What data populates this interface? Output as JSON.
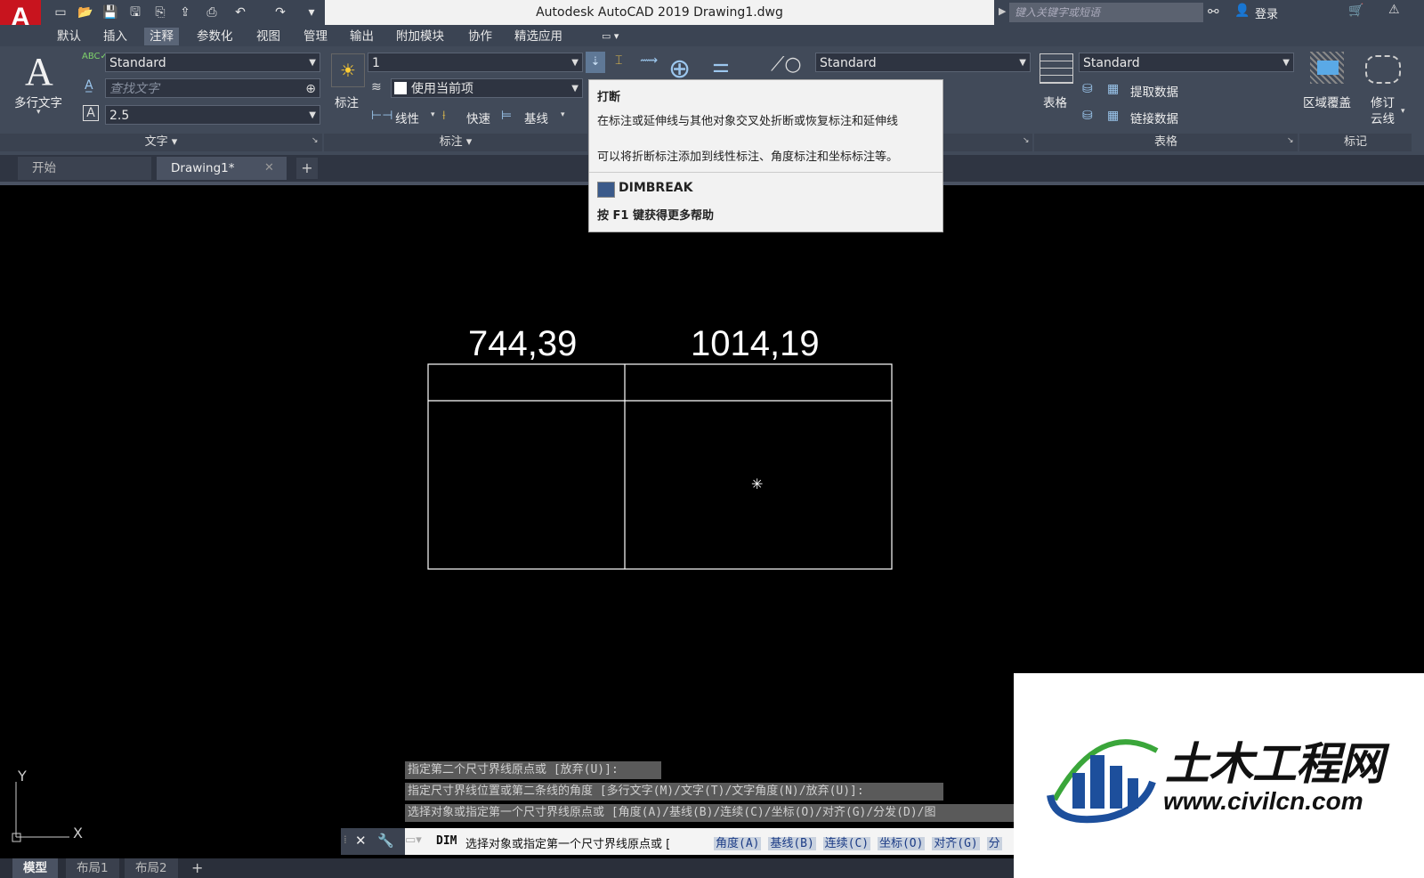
{
  "app": {
    "logo": "A",
    "title": "Autodesk AutoCAD 2019    Drawing1.dwg",
    "search_placeholder": "键入关键字或短语",
    "login": "登录"
  },
  "menu_tabs": [
    "默认",
    "插入",
    "注释",
    "参数化",
    "视图",
    "管理",
    "输出",
    "附加模块",
    "协作",
    "精选应用"
  ],
  "active_tab": "注释",
  "ribbon": {
    "text_panel": {
      "multiline_text": "多行文字",
      "style_combo": "Standard",
      "find_placeholder": "查找文字",
      "height_combo": "2.5",
      "panel_label": "文字"
    },
    "dim_panel": {
      "dimension_label": "标注",
      "dimstyle_combo": "1",
      "layer_combo": "使用当前项",
      "linear": "线性",
      "quick": "快速",
      "baseline": "基线",
      "panel_label": "标注"
    },
    "leader_style_combo": "Standard",
    "table_panel": {
      "table_label": "表格",
      "style_combo": "Standard",
      "extract": "提取数据",
      "link": "链接数据",
      "panel_label": "表格"
    },
    "markup_panel": {
      "wipeout": "区域覆盖",
      "revcloud_1": "修订",
      "revcloud_2": "云线",
      "panel_label": "标记"
    }
  },
  "doc_tabs": {
    "start": "开始",
    "drawing": "Drawing1*"
  },
  "tooltip": {
    "title": "打断",
    "desc1": "在标注或延伸线与其他对象交叉处折断或恢复标注和延伸线",
    "desc2": "可以将折断标注添加到线性标注、角度标注和坐标标注等。",
    "command": "DIMBREAK",
    "help": "按 F1 键获得更多帮助"
  },
  "drawing": {
    "dim1": "744,39",
    "dim2": "1014,19"
  },
  "ucs": {
    "y": "Y",
    "x": "X"
  },
  "command_history": [
    "指定第二个尺寸界线原点或 [放弃(U)]:",
    "指定尺寸界线位置或第二条线的角度 [多行文字(M)/文字(T)/文字角度(N)/放弃(U)]:",
    "选择对象或指定第一个尺寸界线原点或 [角度(A)/基线(B)/连续(C)/坐标(O)/对齐(G)/分发(D)/图"
  ],
  "command_line": {
    "prefix": "DIM",
    "prompt": "选择对象或指定第一个尺寸界线原点或 [",
    "options": [
      "角度(A)",
      "基线(B)",
      "连续(C)",
      "坐标(O)",
      "对齐(G)",
      "分"
    ]
  },
  "layout_tabs": [
    "模型",
    "布局1",
    "布局2"
  ],
  "watermark": {
    "name": "土木工程网",
    "url": "www.civilcn.com"
  }
}
